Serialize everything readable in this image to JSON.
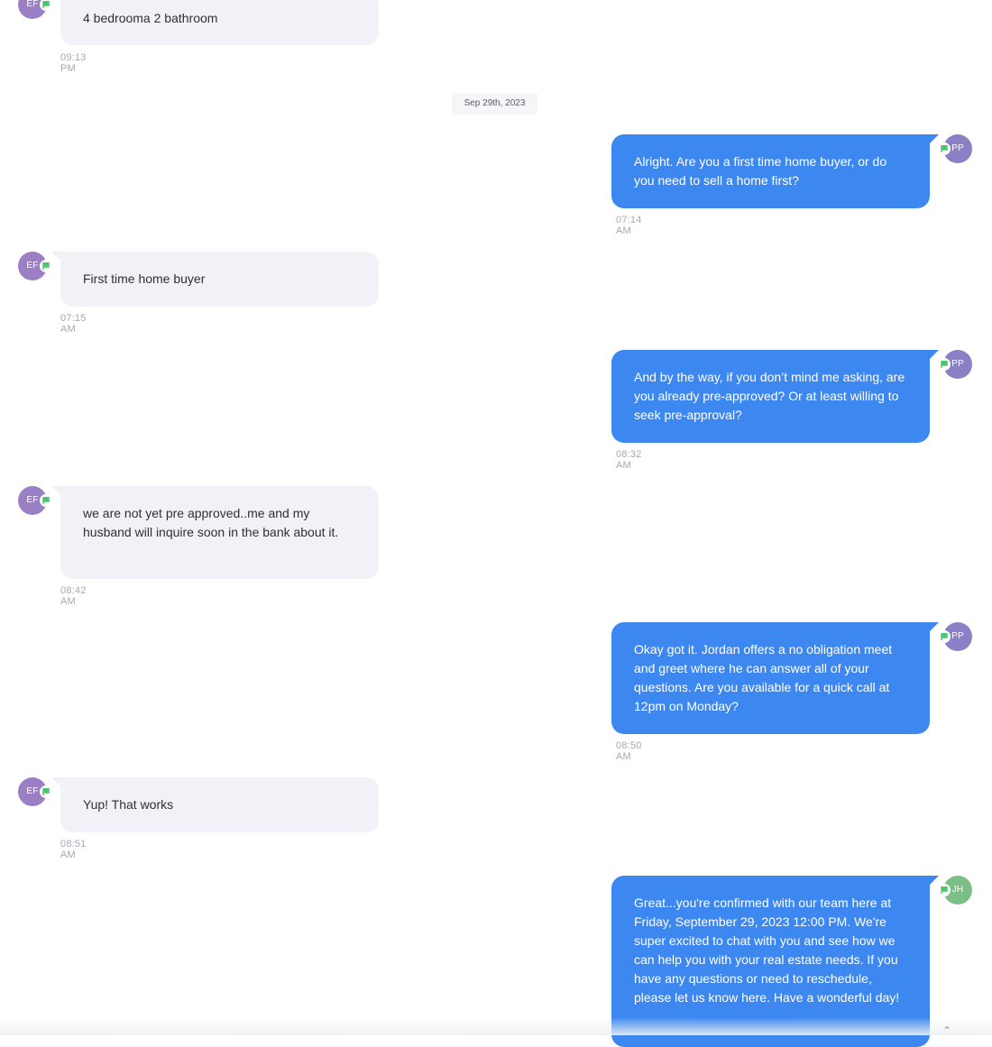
{
  "colors": {
    "incoming_bubble": "#f0f2f7",
    "outgoing_bubble": "#3d87f0",
    "avatar_ef": "#9b7fc4",
    "avatar_pp": "#8b7fc6",
    "avatar_jh": "#7cbf86",
    "flag_badge": "#4fc36e",
    "timestamp": "#a7a9b1"
  },
  "date_separator": "Sep 29th, 2023",
  "messages": [
    {
      "direction": "incoming",
      "avatar": "EF",
      "text": "4 bedrooma 2 bathroom",
      "time": "09:13 PM"
    },
    {
      "direction": "outgoing",
      "avatar": "PP",
      "text": "Alright. Are you a first time home buyer, or do you need to sell a home first?",
      "time": "07:14 AM"
    },
    {
      "direction": "incoming",
      "avatar": "EF",
      "text": "First time home buyer",
      "time": "07:15 AM"
    },
    {
      "direction": "outgoing",
      "avatar": "PP",
      "text": "And by the way, if you don’t mind me asking, are you already pre-approved? Or at least willing to seek pre-approval?",
      "time": "08:32 AM"
    },
    {
      "direction": "incoming",
      "avatar": "EF",
      "text": "we are not yet pre approved..me and my husband will inquire soon in the bank about it.",
      "time": "08:42 AM"
    },
    {
      "direction": "outgoing",
      "avatar": "PP",
      "text": "Okay got it. Jordan offers a no obligation meet and greet where he can answer all of your questions. Are you available for a quick call at 12pm on Monday?",
      "time": "08:50 AM"
    },
    {
      "direction": "incoming",
      "avatar": "EF",
      "text": "Yup! That works",
      "time": "08:51 AM"
    },
    {
      "direction": "outgoing",
      "avatar": "JH",
      "text": "Great...you're confirmed with our team here at Friday, September 29, 2023 12:00 PM. We're super excited to chat with you and see how we can help you with your real estate needs. If you have any questions or need to reschedule, please let us know here. Have a wonderful day!",
      "time": ""
    }
  ]
}
